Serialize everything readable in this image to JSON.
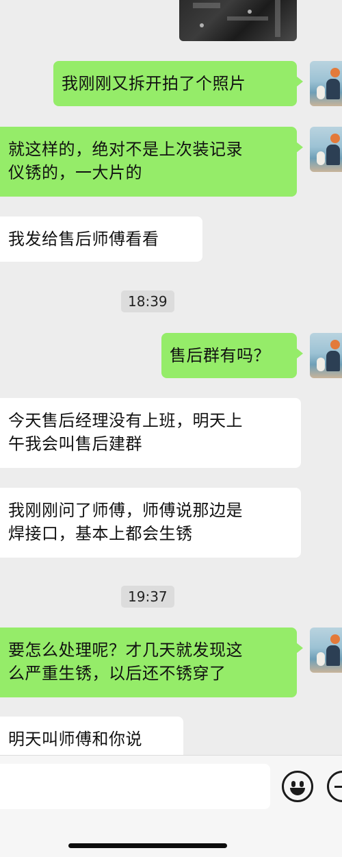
{
  "messages": [
    {
      "from": "me",
      "lines": [
        "我刚刚又拆开拍了个照片"
      ]
    },
    {
      "from": "me",
      "lines": [
        "就这样的，绝对不是上次装记录",
        "仪锈的，一大片的"
      ]
    },
    {
      "from": "other",
      "lines": [
        "我发给售后师傅看看"
      ]
    },
    {
      "from": "me",
      "lines": [
        "售后群有吗？"
      ]
    },
    {
      "from": "other",
      "lines": [
        "今天售后经理没有上班，明天上",
        "午我会叫售后建群"
      ]
    },
    {
      "from": "other",
      "lines": [
        "我刚刚问了师傅，师傅说那边是",
        "焊接口，基本上都会生锈"
      ]
    },
    {
      "from": "me",
      "lines": [
        "要怎么处理呢？才几天就发现这",
        "么严重生锈，以后还不锈穿了"
      ]
    },
    {
      "from": "other",
      "lines": [
        "明天叫师傅和你说"
      ]
    }
  ],
  "timestamps": [
    "18:39",
    "19:37"
  ],
  "input_bar": {
    "text_value": "",
    "emoji_icon": "smiley-face-icon",
    "more_icon": "plus-circle-icon"
  },
  "colors": {
    "background": "#ededed",
    "outgoing_bubble": "#95ec69",
    "incoming_bubble": "#ffffff",
    "timestamp_bg": "#dcdcdc"
  }
}
